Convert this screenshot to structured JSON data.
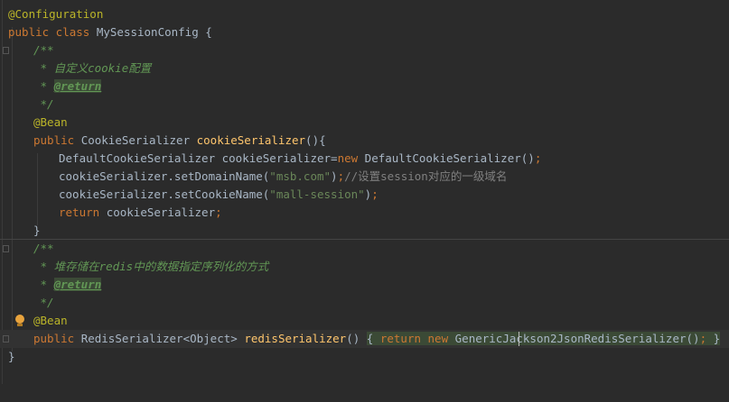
{
  "lines": {
    "l1": {
      "annotation": "@Configuration"
    },
    "l2": {
      "kw": "public class ",
      "name": "MySessionConfig",
      "brace": " {"
    },
    "l3": {
      "text": "/**"
    },
    "l4": {
      "text": " * 自定义cookie配置"
    },
    "l5": {
      "prefix": " * ",
      "tag": "@return"
    },
    "l6": {
      "text": " */"
    },
    "l7": {
      "annotation": "@Bean"
    },
    "l8": {
      "kw": "public ",
      "type": "CookieSerializer ",
      "method": "cookieSerializer",
      "rest": "(){"
    },
    "l9": {
      "a": "DefaultCookieSerializer cookieSerializer=",
      "kw": "new ",
      "b": "DefaultCookieSerializer()",
      "semi": ";"
    },
    "l10": {
      "a": "cookieSerializer.setDomainName(",
      "str": "\"msb.com\"",
      "b": ")",
      "semi": ";",
      "comment": "//设置session对应的一级域名"
    },
    "l11": {
      "a": "cookieSerializer.setCookieName(",
      "str": "\"mall-session\"",
      "b": ")",
      "semi": ";"
    },
    "l12": {
      "kw": "return ",
      "a": "cookieSerializer",
      "semi": ";"
    },
    "l13": {
      "text": "}"
    },
    "l14": {
      "text": "/**"
    },
    "l15": {
      "text": " * 堆存储在redis中的数据指定序列化的方式"
    },
    "l16": {
      "prefix": " * ",
      "tag": "@return"
    },
    "l17": {
      "text": " */"
    },
    "l18": {
      "annotation": "@Bean"
    },
    "l19": {
      "kw": "public ",
      "type": "RedisSerializer<Object> ",
      "method": "redisSerializer",
      "paren": "() ",
      "open": "{ ",
      "kw2": "return ",
      "kw3": "new ",
      "folded": "GenericJackson2JsonRedisSerializer()",
      "semi": ";",
      "close": " }"
    },
    "l20": {
      "text": "}"
    }
  },
  "colors": {
    "background": "#2b2b2b",
    "keyword": "#cc7832",
    "annotation": "#bbb529",
    "doc_comment": "#629755",
    "string": "#6a8759",
    "line_comment": "#808080",
    "method_decl": "#ffc66d",
    "default_text": "#a9b7c6"
  },
  "icons": {
    "intention": "lightbulb-icon"
  }
}
